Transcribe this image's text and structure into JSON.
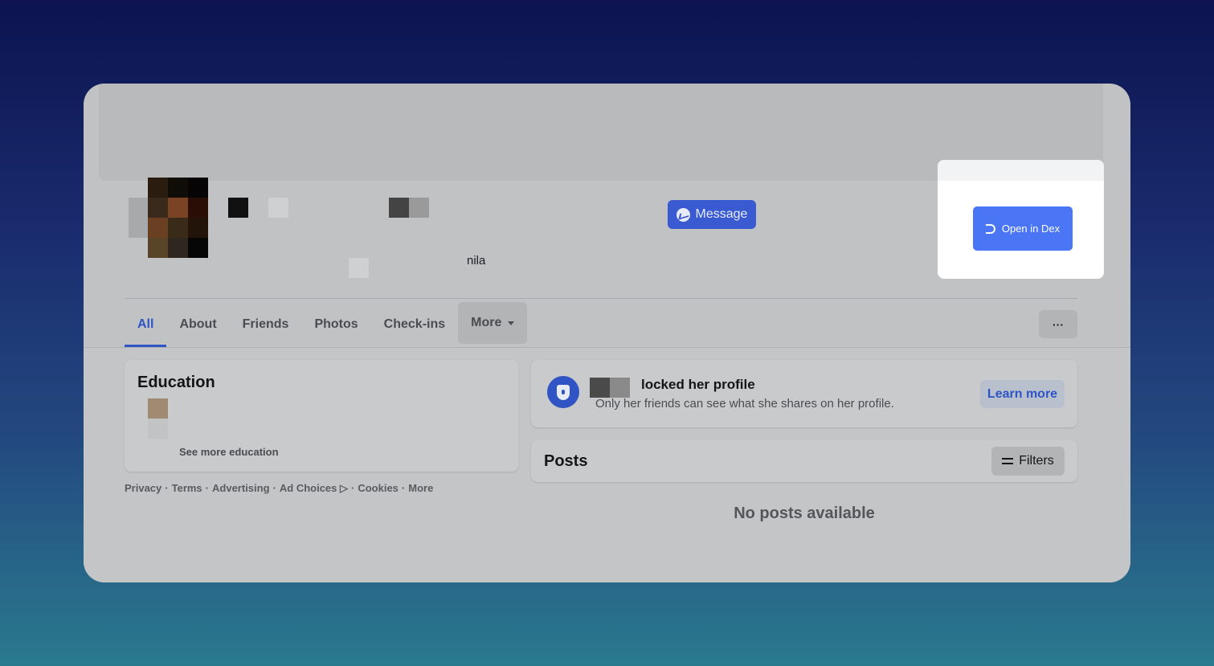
{
  "profile": {
    "location_fragment": "nila",
    "message_label": "Message"
  },
  "extension": {
    "open_label": "Open in Dex"
  },
  "tabs": {
    "all": "All",
    "about": "About",
    "friends": "Friends",
    "photos": "Photos",
    "checkins": "Check-ins",
    "more": "More",
    "active": "All",
    "options_label": "···"
  },
  "education": {
    "title": "Education",
    "see_more": "See more education"
  },
  "footer": {
    "privacy": "Privacy",
    "terms": "Terms",
    "advertising": "Advertising",
    "ad_choices": "Ad Choices ▷",
    "cookies": "Cookies",
    "more": "More",
    "separator": "·"
  },
  "locked": {
    "title": "locked her profile",
    "subtitle": "Only her friends can see what she shares on her profile.",
    "learn_more": "Learn more"
  },
  "posts": {
    "title": "Posts",
    "filters_label": "Filters",
    "empty": "No posts available"
  },
  "colors": {
    "accent": "#3054c4",
    "dex_button": "#4a76f6",
    "message_button": "#3a5ad1"
  }
}
